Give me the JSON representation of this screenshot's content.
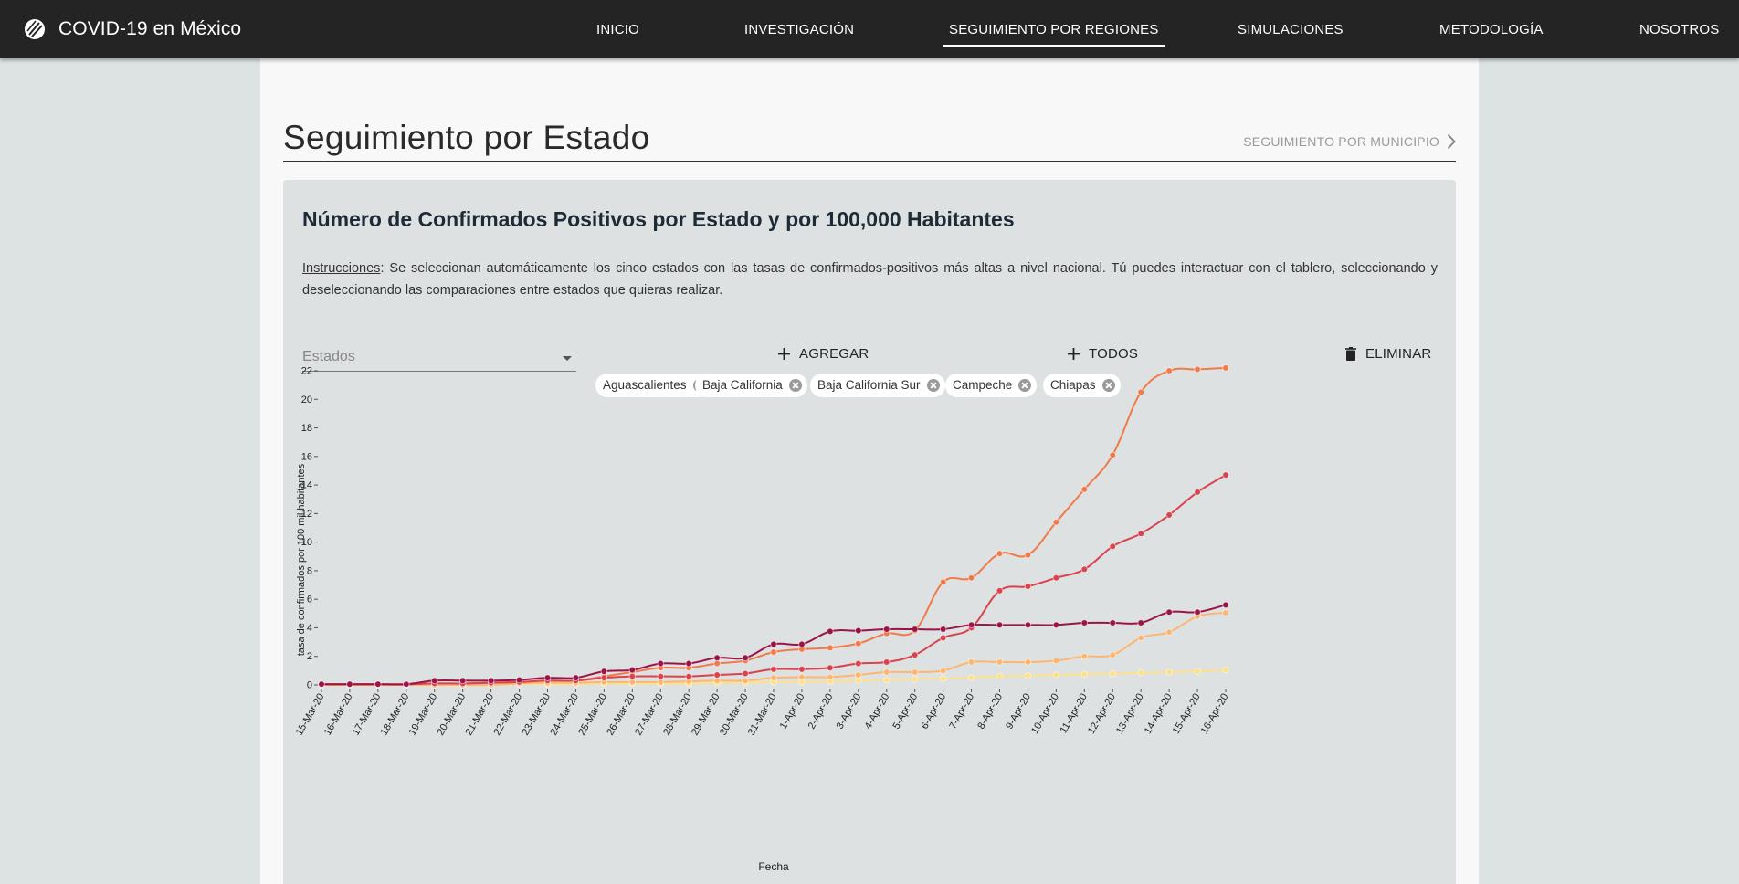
{
  "nav": {
    "brand": "COVID-19 en México",
    "items": [
      {
        "label": "INICIO",
        "active": false
      },
      {
        "label": "INVESTIGACIÓN",
        "active": false
      },
      {
        "label": "SEGUIMIENTO POR REGIONES",
        "active": true
      },
      {
        "label": "SIMULACIONES",
        "active": false
      },
      {
        "label": "METODOLOGÍA",
        "active": false
      },
      {
        "label": "NOSOTROS",
        "active": false
      }
    ]
  },
  "page": {
    "title": "Seguimiento por Estado",
    "municipio_link": "SEGUIMIENTO POR MUNICIPIO"
  },
  "card": {
    "title": "Número de Confirmados Positivos por Estado y por 100,000 Habitantes",
    "instructions_label": "Instrucciones",
    "instructions_text": ": Se seleccionan automáticamente los cinco estados con las tasas de confirmados-positivos más altas a nivel nacional. Tú puedes interactuar con el tablero, seleccionando y deseleccionando las comparaciones entre estados que quieras realizar."
  },
  "controls": {
    "select_placeholder": "Estados",
    "add_label": "AGREGAR",
    "all_label": "TODOS",
    "delete_label": "ELIMINAR",
    "chips": [
      "Aguascalientes",
      "Baja California",
      "Baja California Sur",
      "Campeche",
      "Chiapas"
    ]
  },
  "chart_data": {
    "type": "line",
    "title": "",
    "xlabel": "Fecha",
    "ylabel": "tasa de confirmados por 100 mil habitantes",
    "ylim": [
      0,
      22
    ],
    "yticks": [
      0,
      2,
      4,
      6,
      8,
      10,
      12,
      14,
      16,
      18,
      20,
      22
    ],
    "grid": false,
    "legend": "none",
    "x": [
      "15-Mar-20",
      "16-Mar-20",
      "17-Mar-20",
      "18-Mar-20",
      "19-Mar-20",
      "20-Mar-20",
      "21-Mar-20",
      "22-Mar-20",
      "23-Mar-20",
      "24-Mar-20",
      "25-Mar-20",
      "26-Mar-20",
      "27-Mar-20",
      "28-Mar-20",
      "29-Mar-20",
      "30-Mar-20",
      "31-Mar-20",
      "1-Apr-20",
      "2-Apr-20",
      "3-Apr-20",
      "4-Apr-20",
      "5-Apr-20",
      "6-Apr-20",
      "7-Apr-20",
      "8-Apr-20",
      "9-Apr-20",
      "10-Apr-20",
      "11-Apr-20",
      "12-Apr-20",
      "13-Apr-20",
      "14-Apr-20",
      "15-Apr-20",
      "16-Apr-20"
    ],
    "series": [
      {
        "color": "#f07a4a",
        "values": [
          0.05,
          0.05,
          0.05,
          0.05,
          0.1,
          0.1,
          0.15,
          0.2,
          0.3,
          0.3,
          0.6,
          0.9,
          1.2,
          1.2,
          1.5,
          1.7,
          2.3,
          2.5,
          2.6,
          2.9,
          3.6,
          3.8,
          7.2,
          7.5,
          9.2,
          9.1,
          11.4,
          13.7,
          16.1,
          20.5,
          22.0,
          22.1,
          22.2
        ]
      },
      {
        "color": "#d9434f",
        "values": [
          0.05,
          0.05,
          0.05,
          0.05,
          0.1,
          0.1,
          0.15,
          0.2,
          0.3,
          0.3,
          0.5,
          0.6,
          0.6,
          0.6,
          0.7,
          0.8,
          1.1,
          1.1,
          1.2,
          1.5,
          1.6,
          2.1,
          3.3,
          4.0,
          6.6,
          6.9,
          7.5,
          8.1,
          9.7,
          10.6,
          11.9,
          13.5,
          14.7
        ]
      },
      {
        "color": "#9b1448",
        "values": [
          0.05,
          0.05,
          0.05,
          0.05,
          0.3,
          0.3,
          0.3,
          0.35,
          0.5,
          0.5,
          0.95,
          1.05,
          1.5,
          1.5,
          1.9,
          1.9,
          2.85,
          2.85,
          3.75,
          3.8,
          3.9,
          3.9,
          3.9,
          4.2,
          4.2,
          4.2,
          4.2,
          4.35,
          4.35,
          4.35,
          5.1,
          5.1,
          5.6
        ]
      },
      {
        "color": "#fdb672",
        "values": [
          0.0,
          0.0,
          0.0,
          0.0,
          0.0,
          0.0,
          0.0,
          0.1,
          0.15,
          0.15,
          0.2,
          0.2,
          0.2,
          0.25,
          0.3,
          0.3,
          0.5,
          0.55,
          0.55,
          0.7,
          0.9,
          0.9,
          1.0,
          1.6,
          1.6,
          1.6,
          1.7,
          2.0,
          2.1,
          3.3,
          3.7,
          4.8,
          5.05
        ]
      },
      {
        "color": "#fde08a",
        "values": [
          0.0,
          0.0,
          0.0,
          0.0,
          0.0,
          0.0,
          0.0,
          0.05,
          0.05,
          0.05,
          0.1,
          0.1,
          0.1,
          0.1,
          0.15,
          0.15,
          0.2,
          0.2,
          0.25,
          0.3,
          0.35,
          0.4,
          0.45,
          0.5,
          0.6,
          0.65,
          0.7,
          0.75,
          0.8,
          0.85,
          0.9,
          0.95,
          1.05
        ]
      }
    ]
  }
}
